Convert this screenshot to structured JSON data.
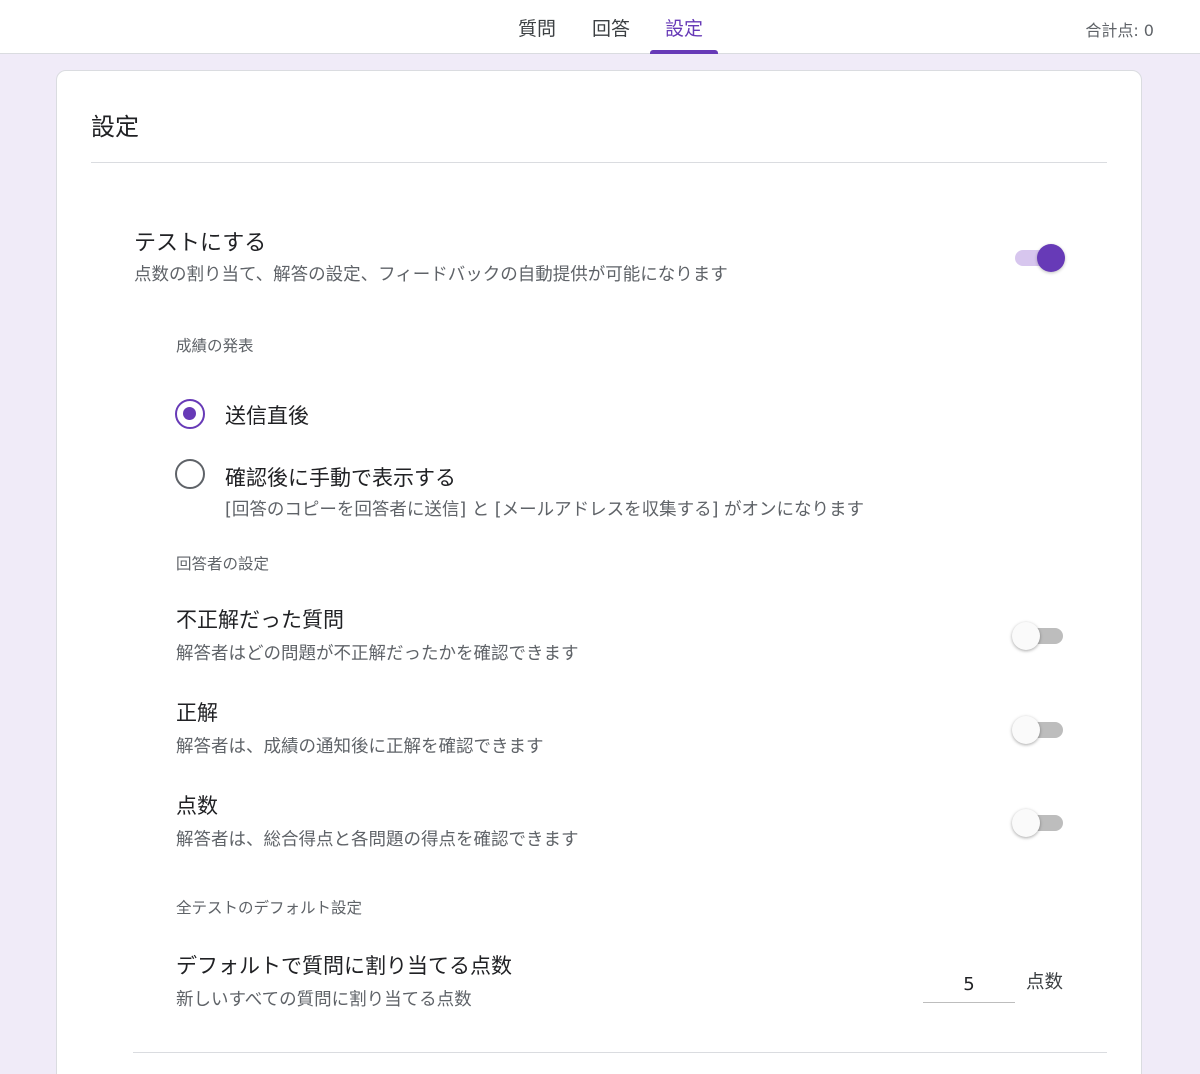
{
  "header": {
    "tabs": [
      {
        "label": "質問",
        "active": false
      },
      {
        "label": "回答",
        "active": false
      },
      {
        "label": "設定",
        "active": true
      }
    ],
    "total_points": "合計点: 0"
  },
  "card": {
    "title": "設定",
    "quiz": {
      "title": "テストにする",
      "description": "点数の割り当て、解答の設定、フィードバックの自動提供が可能になります",
      "enabled": true
    },
    "release_grade": {
      "label": "成績の発表",
      "options": [
        {
          "label": "送信直後",
          "checked": true
        },
        {
          "label": "確認後に手動で表示する",
          "note": "[回答のコピーを回答者に送信] と [メールアドレスを収集する] がオンになります",
          "checked": false
        }
      ]
    },
    "respondent_settings": {
      "label": "回答者の設定",
      "items": [
        {
          "title": "不正解だった質問",
          "description": "解答者はどの問題が不正解だったかを確認できます",
          "enabled": false
        },
        {
          "title": "正解",
          "description": "解答者は、成績の通知後に正解を確認できます",
          "enabled": false
        },
        {
          "title": "点数",
          "description": "解答者は、総合得点と各問題の得点を確認できます",
          "enabled": false
        }
      ]
    },
    "defaults": {
      "label": "全テストのデフォルト設定",
      "point_value": {
        "title": "デフォルトで質問に割り当てる点数",
        "description": "新しいすべての質問に割り当てる点数",
        "value": "5",
        "unit": "点数"
      }
    }
  },
  "colors": {
    "accent": "#673ab7",
    "background": "#f0ebf8"
  }
}
